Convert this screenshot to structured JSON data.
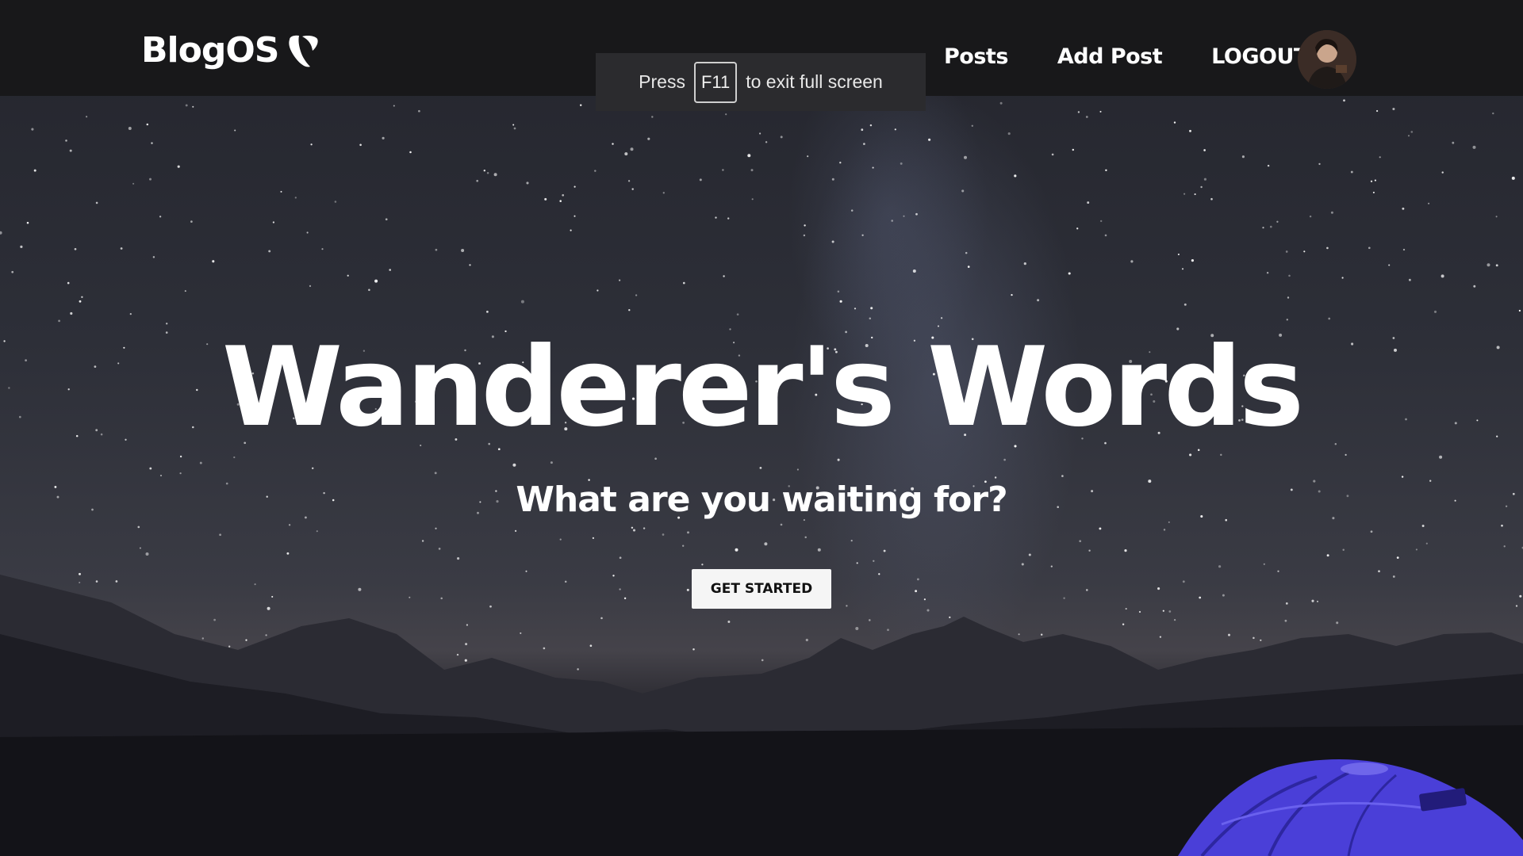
{
  "navbar": {
    "brand": "BlogOS",
    "links": [
      {
        "label": "Posts"
      },
      {
        "label": "Add Post"
      },
      {
        "label": "LOGOUT"
      }
    ]
  },
  "fullscreen_notice": {
    "prefix": "Press",
    "key": "F11",
    "suffix": "to exit full screen"
  },
  "hero": {
    "title": "Wanderer's Words",
    "subtitle": "What are you waiting for?",
    "button_label": "GET STARTED"
  },
  "icons": {
    "brand_logo": "typo3-logo-icon",
    "avatar": "user-avatar"
  },
  "colors": {
    "navbar_bg": "#18181a",
    "text": "#ffffff",
    "button_bg": "#f5f5f5",
    "tent": "#4a3fd8"
  }
}
